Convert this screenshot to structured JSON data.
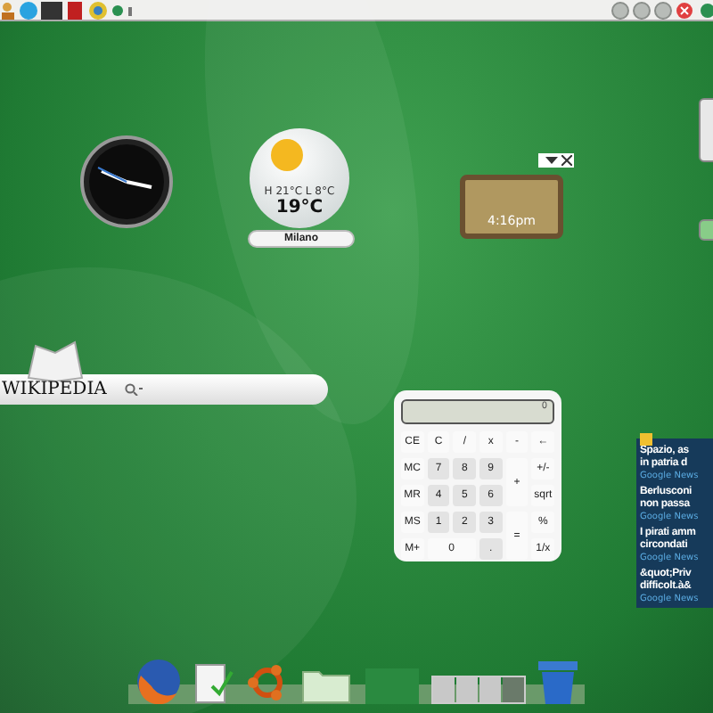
{
  "weather": {
    "high_low": "H 21°C L 8°C",
    "temperature": "19°C",
    "city": "Milano"
  },
  "world_clock": {
    "time": "4:16pm"
  },
  "wikipedia": {
    "logo": "WIKIPEDIA"
  },
  "calculator": {
    "display": "0",
    "keys": [
      {
        "label": "CE",
        "kind": "key"
      },
      {
        "label": "C",
        "kind": "key"
      },
      {
        "label": "/",
        "kind": "key"
      },
      {
        "label": "x",
        "kind": "key"
      },
      {
        "label": "-",
        "kind": "key"
      },
      {
        "label": "←",
        "kind": "key"
      },
      {
        "label": "MC",
        "kind": "key"
      },
      {
        "label": "7",
        "kind": "digit"
      },
      {
        "label": "8",
        "kind": "digit"
      },
      {
        "label": "9",
        "kind": "digit"
      },
      {
        "label": "+",
        "kind": "tall"
      },
      {
        "label": "+/-",
        "kind": "key"
      },
      {
        "label": "MR",
        "kind": "key"
      },
      {
        "label": "4",
        "kind": "digit"
      },
      {
        "label": "5",
        "kind": "digit"
      },
      {
        "label": "6",
        "kind": "digit"
      },
      {
        "label": "sqrt",
        "kind": "key"
      },
      {
        "label": "MS",
        "kind": "key"
      },
      {
        "label": "1",
        "kind": "digit"
      },
      {
        "label": "2",
        "kind": "digit"
      },
      {
        "label": "3",
        "kind": "digit"
      },
      {
        "label": "=",
        "kind": "tall"
      },
      {
        "label": "%",
        "kind": "key"
      },
      {
        "label": "M+",
        "kind": "key"
      },
      {
        "label": "0",
        "kind": "wide"
      },
      {
        "label": ".",
        "kind": "digit"
      },
      {
        "label": "1/x",
        "kind": "key"
      }
    ]
  },
  "news": [
    {
      "title_lines": [
        "Spazio, as",
        "in patria d"
      ],
      "source": "Google News"
    },
    {
      "title_lines": [
        "Berlusconi",
        "non passa"
      ],
      "source": "Google News"
    },
    {
      "title_lines": [
        "I pirati amm",
        "circondati"
      ],
      "source": "Google News"
    },
    {
      "title_lines": [
        "&quot;Priv",
        "difficolt.à&"
      ],
      "source": "Google News"
    }
  ],
  "workspaces": [
    {
      "selected": false
    },
    {
      "selected": false
    },
    {
      "selected": false
    },
    {
      "selected": true
    }
  ]
}
